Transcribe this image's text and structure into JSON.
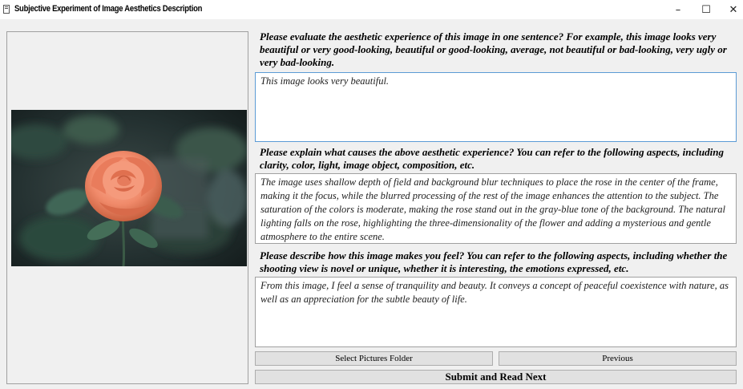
{
  "window": {
    "title": "Subjective Experiment of Image Aesthetics Description",
    "minimize_glyph": "–",
    "maximize_glyph": "☐",
    "close_glyph": "✕"
  },
  "image": {
    "alt": "rose-photo"
  },
  "questions": {
    "q1": "Please evaluate the aesthetic experience of this image in one sentence? For example, this image looks very beautiful or very good-looking, beautiful or good-looking, average, not beautiful or bad-looking, very ugly or very bad-looking.",
    "q2": "Please explain what causes the above aesthetic experience? You can refer to the following aspects, including clarity, color, light, image object, composition, etc.",
    "q3": "Please describe how this image makes you feel? You can refer to the following aspects, including whether the shooting view is novel or unique, whether it is interesting, the emotions expressed, etc."
  },
  "answers": {
    "a1": "This image looks very beautiful.",
    "a2": "The image uses shallow depth of field and background blur techniques to place the rose in the center of the frame, making it the focus, while the blurred processing of the rest of the image enhances the attention to the subject. The saturation of the colors is moderate, making the rose stand out in the gray-blue tone of the background. The natural lighting falls on the rose, highlighting the three-dimensionality of the flower and adding a mysterious and gentle atmosphere to the entire scene.",
    "a3": "From this image, I feel a sense of tranquility and beauty. It conveys a concept of peaceful coexistence with nature, as well as an appreciation for the subtle beauty of life."
  },
  "buttons": {
    "select_folder": "Select Pictures Folder",
    "previous": "Previous",
    "submit": "Submit and Read Next"
  },
  "colors": {
    "rose": "#f08a6a",
    "background_dark": "#1f2a2a",
    "leaf": "#3a5a4c",
    "focus_border": "#5b9bd5"
  }
}
